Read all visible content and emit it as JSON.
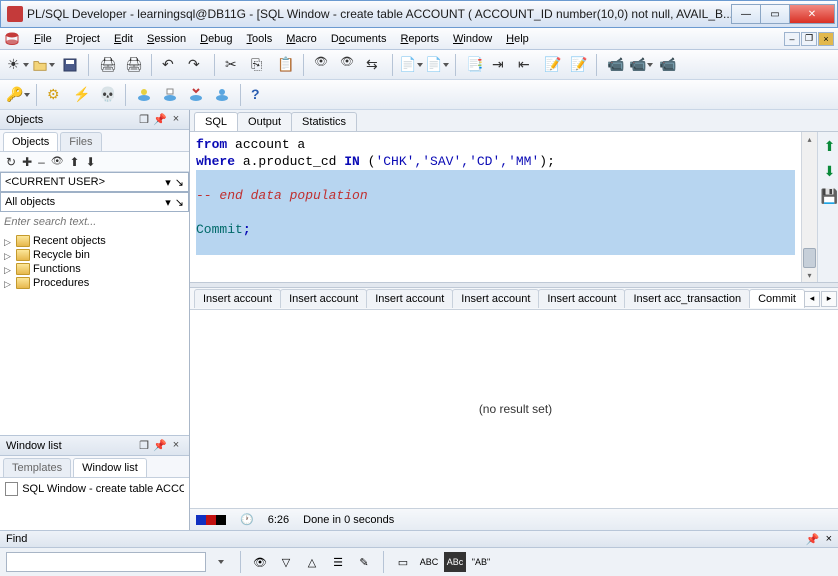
{
  "titlebar": {
    "title": "PL/SQL Developer - learningsql@DB11G - [SQL Window - create table ACCOUNT ( ACCOUNT_ID number(10,0) not null, AVAIL_B..."
  },
  "menu": {
    "file": "File",
    "project": "Project",
    "edit": "Edit",
    "session": "Session",
    "debug": "Debug",
    "tools": "Tools",
    "macro": "Macro",
    "documents": "Documents",
    "reports": "Reports",
    "window": "Window",
    "help": "Help"
  },
  "objects": {
    "title": "Objects",
    "tabs": {
      "objects": "Objects",
      "files": "Files"
    },
    "current_user": "<CURRENT USER>",
    "all_objects": "All objects",
    "search_placeholder": "Enter search text...",
    "tree": [
      "Recent objects",
      "Recycle bin",
      "Functions",
      "Procedures"
    ]
  },
  "windowlist": {
    "title": "Window list",
    "tabs": {
      "templates": "Templates",
      "windowlist": "Window list"
    },
    "item": "SQL Window - create table ACCOU"
  },
  "sql": {
    "tabs": {
      "sql": "SQL",
      "output": "Output",
      "statistics": "Statistics"
    },
    "line1_kw1": "from",
    "line1_ident": " account a",
    "line2_kw1": "where",
    "line2_txt": " a.product_cd ",
    "line2_kw2": "IN",
    "line2_paren": " (",
    "line2_str": "'CHK','SAV','CD','MM'",
    "line2_end": ");",
    "line4_cmt": "-- end data population",
    "line6_commit": "Commit",
    "line6_semi": ";"
  },
  "results": {
    "tabs": [
      "Insert account",
      "Insert account",
      "Insert account",
      "Insert account",
      "Insert account",
      "Insert acc_transaction",
      "Commit"
    ],
    "no_result": "(no result set)"
  },
  "status": {
    "pos": "6:26",
    "msg": "Done in 0 seconds"
  },
  "find": {
    "title": "Find",
    "abc": "ABC",
    "abcbtn": "ABc",
    "ab": "\"AB\""
  }
}
